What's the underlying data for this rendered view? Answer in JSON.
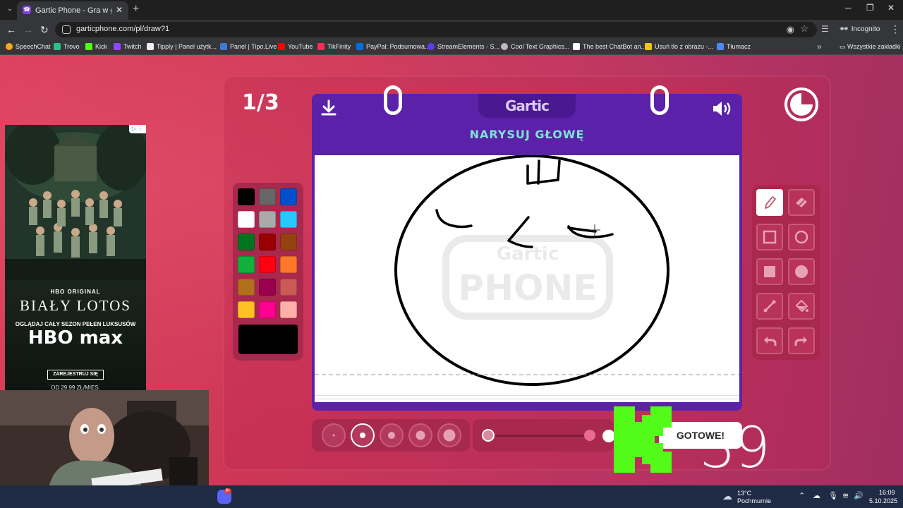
{
  "browser": {
    "tab_title": "Gartic Phone - Gra w głuchy telefon",
    "url": "garticphone.com/pl/draw?1",
    "incognito_label": "Incognito",
    "bookmarks": [
      "SpeechChat",
      "Trovo",
      "Kick",
      "Twitch",
      "Tipply | Panel użytk...",
      "Panel | Tipo.Live",
      "YouTube",
      "TikFinity",
      "PayPal: Podsumowa...",
      "StreamElements - S...",
      "Cool Text Graphics...",
      "The best ChatBot an...",
      "Usuń tło z obrazu -...",
      "Tłumacz"
    ],
    "bookmarks_all": "Wszystkie zakładki"
  },
  "game": {
    "round": "1/3",
    "logo": "Gartic",
    "prompt": "NARYSUJ GŁOWĘ",
    "done_button": "GOTOWE!",
    "current_color": "#000000",
    "palette": [
      "#000000",
      "#666666",
      "#0050cd",
      "#ffffff",
      "#aaaaaa",
      "#26c9ff",
      "#017420",
      "#990000",
      "#964112",
      "#11b03c",
      "#ff0013",
      "#ff7829",
      "#b0701c",
      "#99004e",
      "#cb5a57",
      "#ffc126",
      "#ff008f",
      "#feafa8"
    ],
    "tools": [
      "pencil-icon",
      "eraser-icon",
      "square-outline-icon",
      "circle-outline-icon",
      "square-filled-icon",
      "circle-filled-icon",
      "line-icon",
      "fill-bucket-icon",
      "undo-icon",
      "redo-icon"
    ],
    "active_tool": "pencil-icon",
    "brush_size_selected_index": 1,
    "opacity_level": 1.0,
    "kick_count": "39",
    "watermark": "Gartic PHONE"
  },
  "ad": {
    "badge": "▷ ⋮",
    "hbo_original": "HBO ORIGINAL",
    "title": "BIAŁY LOTOS",
    "subtitle": "OGLĄDAJ CAŁY SEZON PEŁEN LUKSUSÓW",
    "brand": "HBO max",
    "cta": "ZAREJESTRUJ SIĘ",
    "price": "OD 29,99 ZŁ/MIES."
  },
  "taskbar": {
    "discord_badge": "9+",
    "temp": "13°C",
    "weather": "Pochmurnie",
    "time": "16:09",
    "date": "5.10.2025"
  },
  "colors": {
    "page_bg": "#d03a58",
    "notebook_purple": "#5b21a8",
    "prompt_teal": "#7de3d4",
    "panel_dark": "#a9284d",
    "kick_green": "#53fc18"
  }
}
